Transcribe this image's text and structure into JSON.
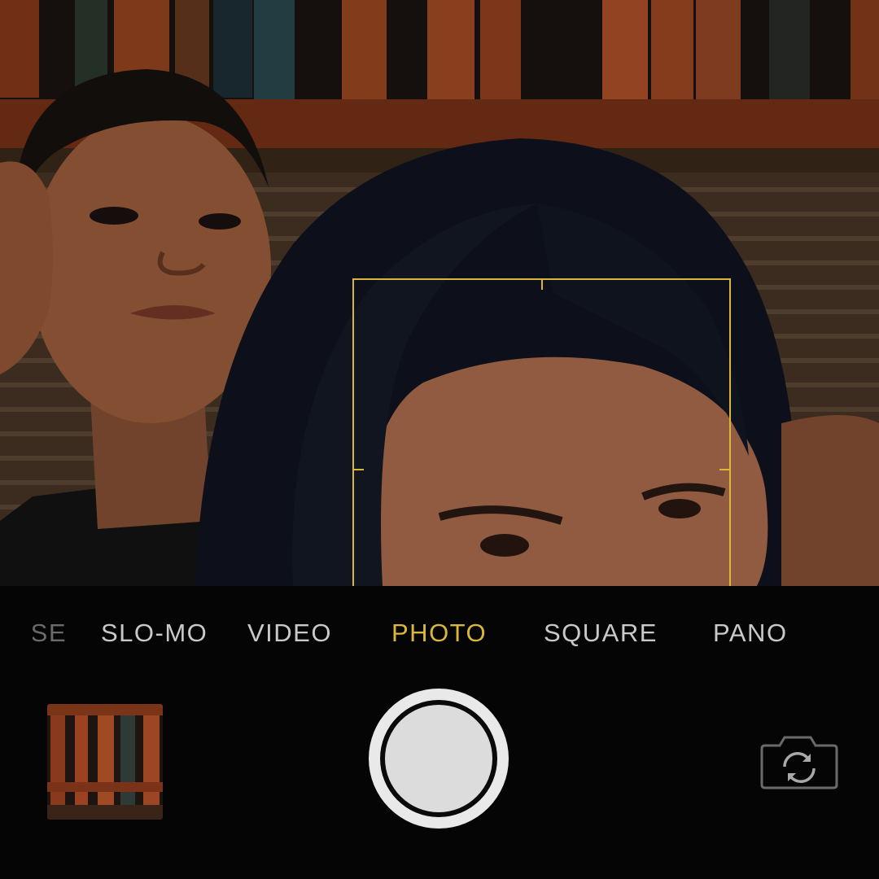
{
  "camera": {
    "modes": [
      {
        "id": "time-lapse",
        "label": "SE",
        "state": "faded"
      },
      {
        "id": "slo-mo",
        "label": "SLO-MO",
        "state": "normal"
      },
      {
        "id": "video",
        "label": "VIDEO",
        "state": "normal"
      },
      {
        "id": "photo",
        "label": "PHOTO",
        "state": "active"
      },
      {
        "id": "square",
        "label": "SQUARE",
        "state": "normal"
      },
      {
        "id": "pano",
        "label": "PANO",
        "state": "normal"
      }
    ],
    "active_mode": "PHOTO",
    "icons": {
      "shutter": "shutter-button",
      "flip": "camera-flip-icon",
      "thumbnail": "last-photo-thumbnail"
    },
    "colors": {
      "accent": "#d9b73c",
      "focus_box": "#d9b53a",
      "mode_text": "#c9c9c9",
      "background": "#050505"
    }
  }
}
